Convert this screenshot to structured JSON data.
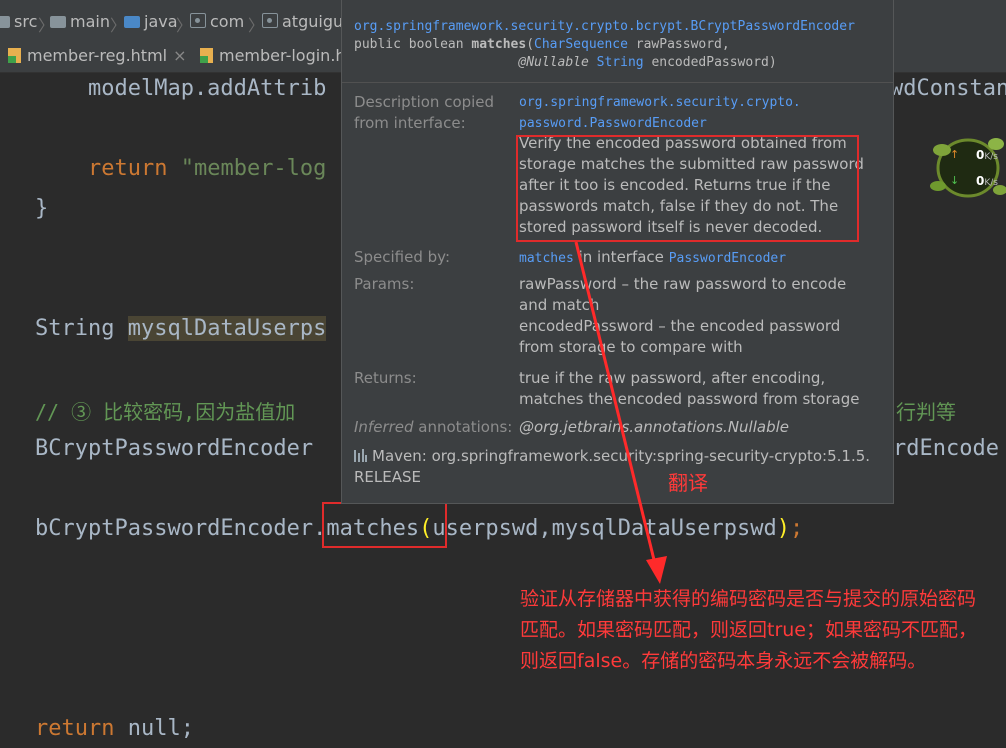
{
  "breadcrumb": {
    "items": [
      "src",
      "main",
      "java",
      "com",
      "atguigu"
    ]
  },
  "tabs": [
    {
      "label": "member-reg.html",
      "close": "×"
    },
    {
      "label": "member-login.h"
    }
  ],
  "code": {
    "line1": {
      "a": "    modelMap.addAttrib",
      "b": "wdConstan"
    },
    "line2": {
      "pre": "    ",
      "kw": "return",
      "str": "\"member-log"
    },
    "line3": "}",
    "line4": {
      "a": "String ",
      "var": "mysqlDataUserps"
    },
    "line5": {
      "a": "// ③ 比较密码,因为盐值加",
      "b": "行判等"
    },
    "line6": {
      "a": "BCryptPasswordEncoder ",
      "b": "rdEncode"
    },
    "line7": {
      "a": "bCryptPasswordEncoder",
      "b": ".matches",
      "paren_open": "(",
      "c": "userpswd,mysqlDataUserpswd",
      "paren_close": ")",
      "d": ";"
    },
    "line8": {
      "kw": "return",
      "rest": " null;"
    }
  },
  "popup": {
    "signature": {
      "class_fqn": "org.springframework.security.crypto.bcrypt.BCryptPasswordEncoder",
      "mods": "public boolean ",
      "method": "matches",
      "open": "(",
      "param1_type": "CharSequence",
      "param1_name": " rawPassword,",
      "indent": "                     ",
      "annotation": "@Nullable",
      "param2_type": "String",
      "param2_name": " encodedPassword)"
    },
    "desc_label_1": "Description copied",
    "desc_label_2": "from interface:",
    "desc_link_1": "org.springframework.security.crypto.",
    "desc_link_2": "password.PasswordEncoder",
    "desc_text": "Verify the encoded password obtained from storage matches the submitted raw password after it too is encoded. Returns true if the passwords match, false if they do not. The stored password itself is never decoded.",
    "specified_label": "Specified by:",
    "specified_method": "matches",
    "specified_mid": " in interface ",
    "specified_iface": "PasswordEncoder",
    "params_label": "Params:",
    "params_text_1": "rawPassword – the raw password to encode and match",
    "params_text_2": "encodedPassword – the encoded password from storage to compare with",
    "returns_label": "Returns:",
    "returns_text": "true if the raw password, after encoding, matches the encoded password from storage",
    "inferred_label_italic": "Inferred",
    "inferred_label_rest": " annotations:",
    "inferred_value": "@org.jetbrains.annotations.Nullable",
    "maven_text_1": "Maven: org.springframework.security:spring-security-crypto:5.1.5.",
    "maven_text_2": "RELEASE"
  },
  "annotations": {
    "translate_label": "翻译",
    "translation": "验证从存储器中获得的编码密码是否与提交的原始密码匹配。如果密码匹配，则返回true；如果密码不匹配，则返回false。存储的密码本身永远不会被解码。",
    "color": "#ff3a3a"
  },
  "widget": {
    "up": "0",
    "down": "0",
    "unit": "K/s"
  }
}
